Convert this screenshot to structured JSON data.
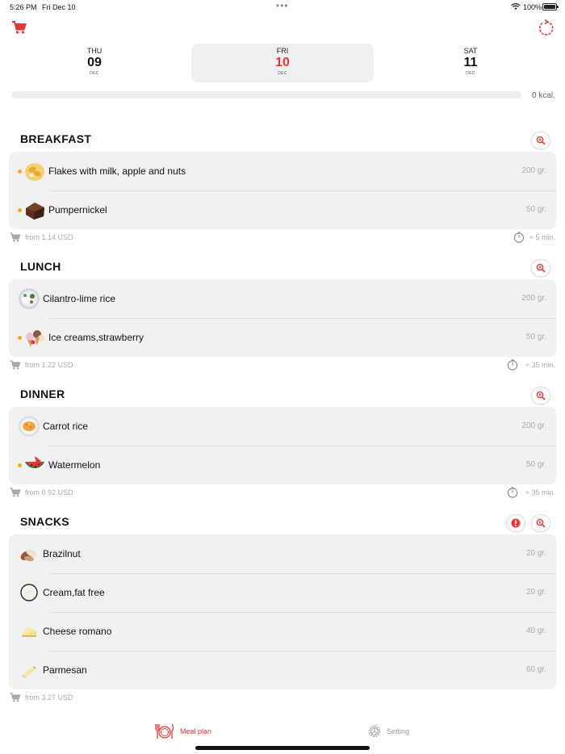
{
  "status_bar": {
    "time": "5:26 PM",
    "date": "Fri Dec 10",
    "battery": "100%"
  },
  "colors": {
    "accent": "#e53935",
    "dot": "#f5a623",
    "card_bg": "#f1f1f4"
  },
  "header": {
    "cart_icon": "cart-icon",
    "refresh_icon": "refresh-icon"
  },
  "days": [
    {
      "name": "THU",
      "num": "09",
      "month": "DEC",
      "selected": false
    },
    {
      "name": "FRI",
      "num": "10",
      "month": "DEC",
      "selected": true
    },
    {
      "name": "SAT",
      "num": "11",
      "month": "DEC",
      "selected": false
    }
  ],
  "calories": {
    "label": "0 kcal.",
    "progress": 0
  },
  "meals": {
    "breakfast": {
      "title": "BREAKFAST",
      "items": [
        {
          "name": "Flakes with milk, apple and nuts",
          "amount": "200 gr."
        },
        {
          "name": "Pumpernickel",
          "amount": "50 gr."
        }
      ],
      "price": "from 1.14 USD",
      "time": "≈ 5 min."
    },
    "lunch": {
      "title": "LUNCH",
      "items": [
        {
          "name": "Cilantro-lime rice",
          "amount": "200 gr."
        },
        {
          "name": "Ice creams,strawberry",
          "amount": "50 gr."
        }
      ],
      "price": "from 1.22 USD",
      "time": "≈ 35 min."
    },
    "dinner": {
      "title": "DINNER",
      "items": [
        {
          "name": "Carrot rice",
          "amount": "200 gr."
        },
        {
          "name": "Watermelon",
          "amount": "50 gr."
        }
      ],
      "price": "from 0.92 USD",
      "time": "≈ 35 min."
    },
    "snacks": {
      "title": "SNACKS",
      "items": [
        {
          "name": "Brazilnut",
          "amount": "20 gr."
        },
        {
          "name": "Cream,fat free",
          "amount": "20 gr."
        },
        {
          "name": "Cheese romano",
          "amount": "40 gr."
        },
        {
          "name": "Parmesan",
          "amount": "60 gr."
        }
      ],
      "price": "from 3.27 USD"
    }
  },
  "tabs": [
    {
      "label": "Meal plan",
      "icon": "meal-plan-icon",
      "active": true
    },
    {
      "label": "Setting",
      "icon": "setting-icon",
      "active": false
    }
  ]
}
